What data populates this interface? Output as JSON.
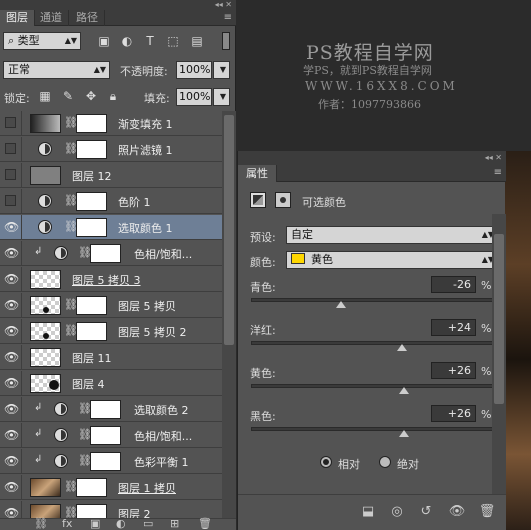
{
  "layers_panel": {
    "tabs": [
      "图层",
      "通道",
      "路径"
    ],
    "filter_kind": "类型",
    "blend_mode": "正常",
    "opacity_label": "不透明度:",
    "opacity_value": "100%",
    "lock_label": "锁定:",
    "fill_label": "填充:",
    "fill_value": "100%",
    "layers": [
      {
        "name": "渐变填充 1",
        "visible": false,
        "kind": "gradient"
      },
      {
        "name": "照片滤镜 1",
        "visible": false,
        "kind": "adjustment"
      },
      {
        "name": "图层 12",
        "visible": false,
        "kind": "gray"
      },
      {
        "name": "色阶 1",
        "visible": false,
        "kind": "adjustment"
      },
      {
        "name": "选取颜色 1",
        "visible": true,
        "kind": "adjustment",
        "selected": true
      },
      {
        "name": "色相/饱和...",
        "visible": true,
        "kind": "adjustment",
        "clipped": true
      },
      {
        "name": "图层 5 拷贝 3",
        "visible": true,
        "kind": "check"
      },
      {
        "name": "图层 5 拷贝",
        "visible": true,
        "kind": "check-mask"
      },
      {
        "name": "图层 5 拷贝 2",
        "visible": true,
        "kind": "check-mask"
      },
      {
        "name": "图层 11",
        "visible": true,
        "kind": "check"
      },
      {
        "name": "图层 4",
        "visible": true,
        "kind": "check"
      },
      {
        "name": "选取颜色 2",
        "visible": true,
        "kind": "adjustment",
        "clipped": true
      },
      {
        "name": "色相/饱和...",
        "visible": true,
        "kind": "adjustment",
        "clipped": true
      },
      {
        "name": "色彩平衡 1",
        "visible": true,
        "kind": "adjustment",
        "clipped": true
      },
      {
        "name": "图层 1 拷贝",
        "visible": true,
        "kind": "photo-mask"
      },
      {
        "name": "图层 2",
        "visible": true,
        "kind": "photo"
      }
    ]
  },
  "watermark": {
    "line1": "PS教程自学网",
    "line2": "学PS，就到PS教程自学网",
    "line3": "WWW.16XX8.COM",
    "line4": "作者：1097793866"
  },
  "properties_panel": {
    "tab": "属性",
    "title": "可选颜色",
    "preset_label": "预设:",
    "preset_value": "自定",
    "colors_label": "颜色:",
    "colors_value": "黄色",
    "swatch_color": "#ffd700",
    "sliders": [
      {
        "label": "青色:",
        "value": "-26",
        "unit": "%",
        "fraction": 0.37
      },
      {
        "label": "洋红:",
        "value": "+24",
        "unit": "%",
        "fraction": 0.62
      },
      {
        "label": "黄色:",
        "value": "+26",
        "unit": "%",
        "fraction": 0.63
      },
      {
        "label": "黑色:",
        "value": "+26",
        "unit": "%",
        "fraction": 0.63
      }
    ],
    "method_relative": "相对",
    "method_absolute": "绝对",
    "method_selected": "relative"
  },
  "colors": {
    "panel_bg": "#535353",
    "selected_row": "#6e7f96",
    "dark_bg": "#2b2b2b"
  }
}
